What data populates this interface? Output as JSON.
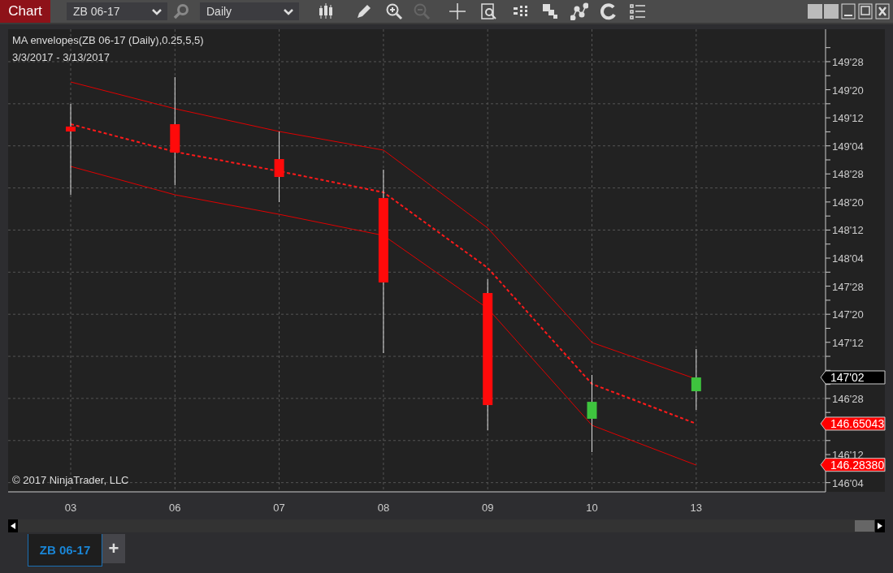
{
  "toolbar": {
    "title": "Chart",
    "instrument": "ZB 06-17",
    "interval": "Daily"
  },
  "chart": {
    "indicator_label": "MA envelopes(ZB 06-17 (Daily),0.25,5,5)",
    "date_range": "3/3/2017 - 3/13/2017",
    "copyright": "© 2017 NinjaTrader, LLC",
    "date_axis": [
      "03",
      "06",
      "07",
      "08",
      "09",
      "10",
      "13"
    ],
    "price_axis": [
      "149'28",
      "149'20",
      "149'12",
      "149'04",
      "148'28",
      "148'20",
      "148'12",
      "148'04",
      "147'28",
      "147'20",
      "147'12",
      "146'28",
      "146'12",
      "146'04"
    ],
    "price_markers": [
      {
        "kind": "price",
        "label": "147'02"
      },
      {
        "kind": "indicator",
        "label": "146.65043"
      },
      {
        "kind": "indicator",
        "label": "146.28380"
      }
    ]
  },
  "tabs": [
    {
      "label": "ZB 06-17",
      "selected": true
    }
  ],
  "add_tab": "+"
}
